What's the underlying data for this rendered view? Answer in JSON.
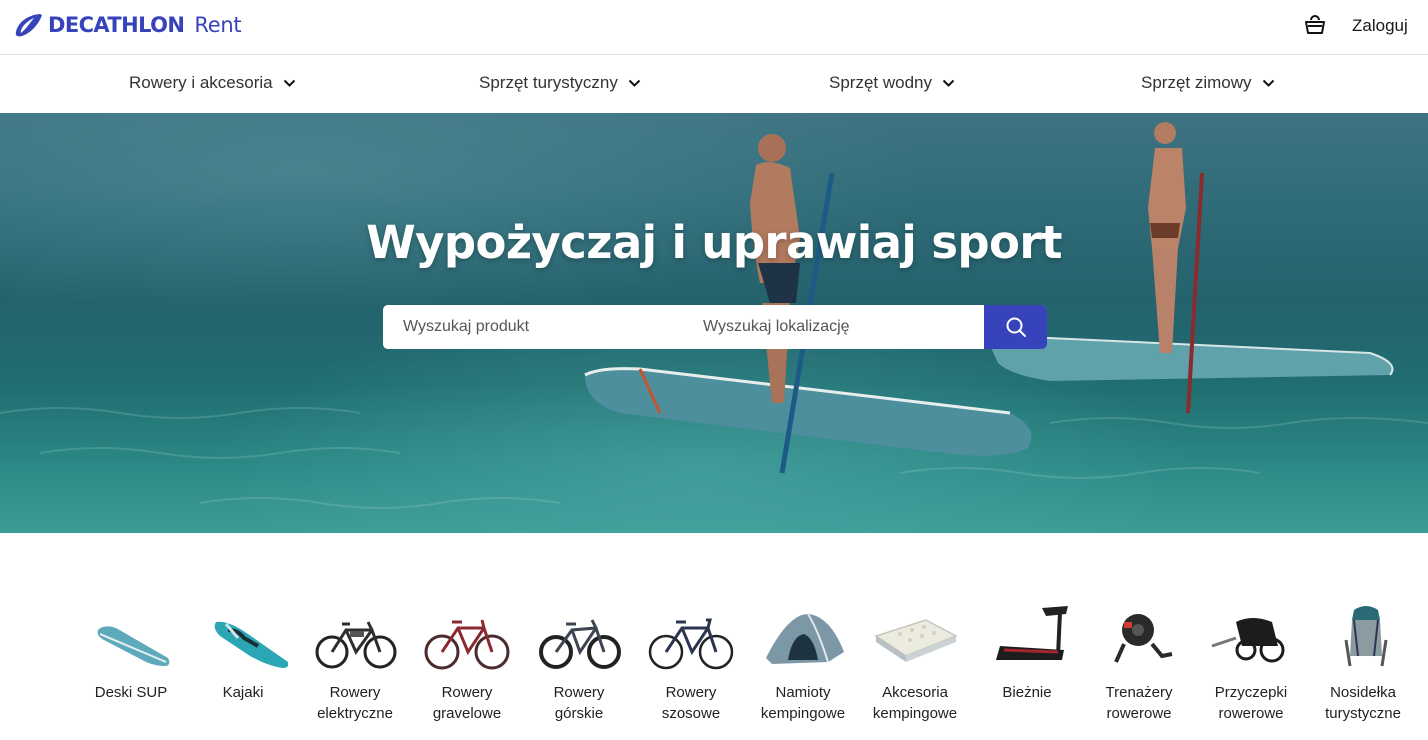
{
  "header": {
    "brand": "DECATHLON",
    "brand_suffix": "Rent",
    "cart_icon": "basket-icon",
    "login_label": "Zaloguj"
  },
  "category_nav": [
    {
      "label": "Rowery i akcesoria"
    },
    {
      "label": "Sprzęt turystyczny"
    },
    {
      "label": "Sprzęt wodny"
    },
    {
      "label": "Sprzęt zimowy"
    }
  ],
  "hero": {
    "title": "Wypożyczaj i uprawiaj sport",
    "product_placeholder": "Wyszukaj produkt",
    "location_placeholder": "Wyszukaj lokalizację",
    "search_icon": "search-icon"
  },
  "categories": [
    {
      "line1": "Deski SUP",
      "line2": ""
    },
    {
      "line1": "Kajaki",
      "line2": ""
    },
    {
      "line1": "Rowery",
      "line2": "elektryczne"
    },
    {
      "line1": "Rowery",
      "line2": "gravelowe"
    },
    {
      "line1": "Rowery",
      "line2": "górskie"
    },
    {
      "line1": "Rowery",
      "line2": "szosowe"
    },
    {
      "line1": "Namioty",
      "line2": "kempingowe"
    },
    {
      "line1": "Akcesoria",
      "line2": "kempingowe"
    },
    {
      "line1": "Bieżnie",
      "line2": ""
    },
    {
      "line1": "Trenażery",
      "line2": "rowerowe"
    },
    {
      "line1": "Przyczepki",
      "line2": "rowerowe"
    },
    {
      "line1": "Nosidełka",
      "line2": "turystyczne"
    }
  ],
  "colors": {
    "brand": "#3643ba",
    "text": "#101010"
  }
}
